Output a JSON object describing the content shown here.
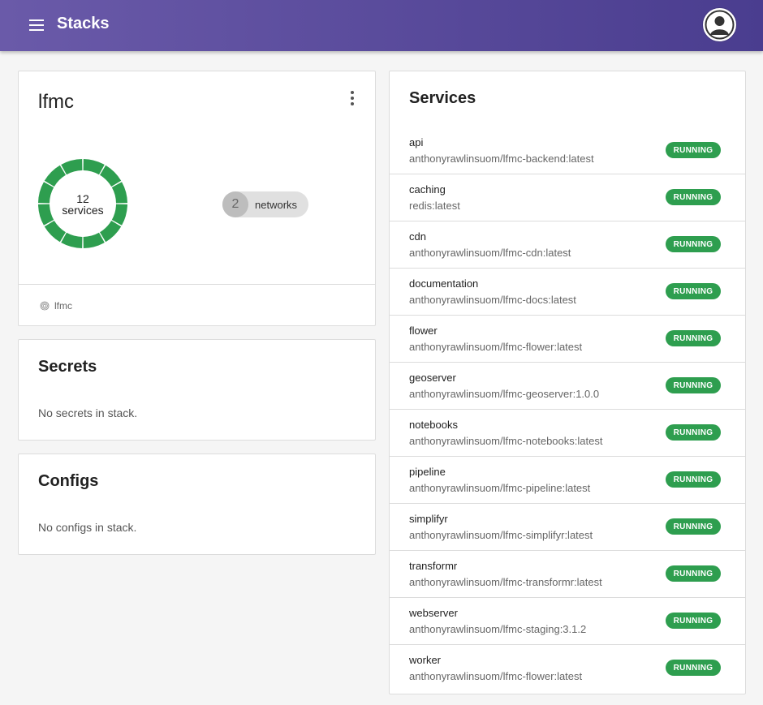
{
  "appbar": {
    "title": "Stacks",
    "menu_icon": "hamburger-menu-icon",
    "avatar_icon": "user-avatar-icon"
  },
  "stack": {
    "name": "lfmc",
    "more_icon": "more-vert-icon",
    "services_count": "12",
    "services_label": "services",
    "networks_count": "2",
    "networks_label": "networks",
    "footer_label": "lfmc",
    "footer_icon": "fingerprint-icon",
    "donut_color": "#2e9e4f"
  },
  "secrets": {
    "title": "Secrets",
    "empty": "No secrets in stack."
  },
  "configs": {
    "title": "Configs",
    "empty": "No configs in stack."
  },
  "services": {
    "title": "Services",
    "status_color": "#2e9e4f",
    "items": [
      {
        "name": "api",
        "image": "anthonyrawlinsuom/lfmc-backend:latest",
        "status": "RUNNING"
      },
      {
        "name": "caching",
        "image": "redis:latest",
        "status": "RUNNING"
      },
      {
        "name": "cdn",
        "image": "anthonyrawlinsuom/lfmc-cdn:latest",
        "status": "RUNNING"
      },
      {
        "name": "documentation",
        "image": "anthonyrawlinsuom/lfmc-docs:latest",
        "status": "RUNNING"
      },
      {
        "name": "flower",
        "image": "anthonyrawlinsuom/lfmc-flower:latest",
        "status": "RUNNING"
      },
      {
        "name": "geoserver",
        "image": "anthonyrawlinsuom/lfmc-geoserver:1.0.0",
        "status": "RUNNING"
      },
      {
        "name": "notebooks",
        "image": "anthonyrawlinsuom/lfmc-notebooks:latest",
        "status": "RUNNING"
      },
      {
        "name": "pipeline",
        "image": "anthonyrawlinsuom/lfmc-pipeline:latest",
        "status": "RUNNING"
      },
      {
        "name": "simplifyr",
        "image": "anthonyrawlinsuom/lfmc-simplifyr:latest",
        "status": "RUNNING"
      },
      {
        "name": "transformr",
        "image": "anthonyrawlinsuom/lfmc-transformr:latest",
        "status": "RUNNING"
      },
      {
        "name": "webserver",
        "image": "anthonyrawlinsuom/lfmc-staging:3.1.2",
        "status": "RUNNING"
      },
      {
        "name": "worker",
        "image": "anthonyrawlinsuom/lfmc-flower:latest",
        "status": "RUNNING"
      }
    ]
  }
}
